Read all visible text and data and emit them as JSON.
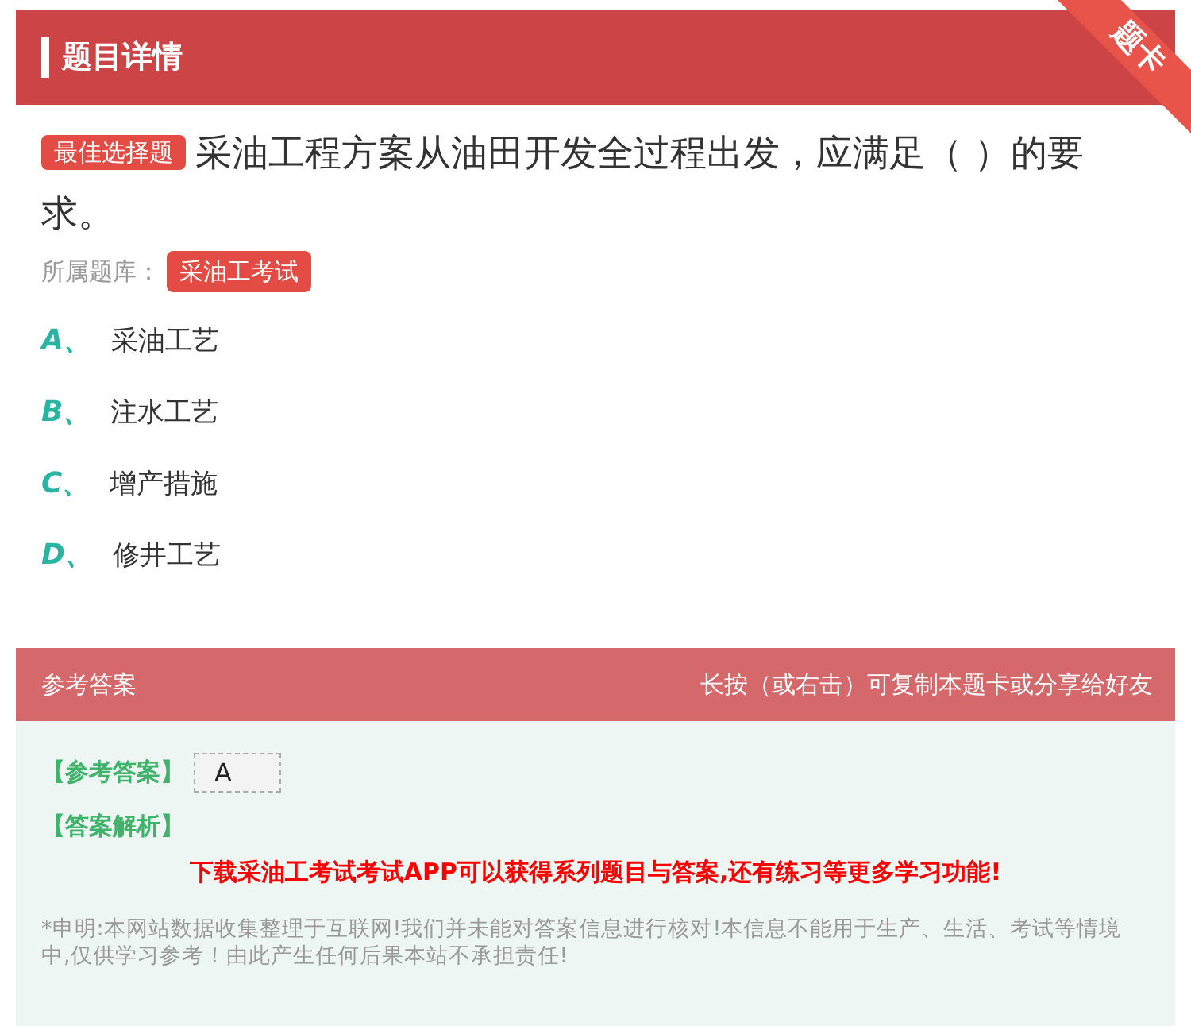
{
  "header": {
    "title": "题目详情",
    "ribbon": "题卡"
  },
  "question": {
    "type_tag": "最佳选择题",
    "text": "采油工程方案从油田开发全过程出发，应满足（ ）的要求。",
    "bank_label": "所属题库：",
    "bank": "采油工考试"
  },
  "options": [
    {
      "letter": "A、",
      "text": "采油工艺"
    },
    {
      "letter": "B、",
      "text": "注水工艺"
    },
    {
      "letter": "C、",
      "text": "增产措施"
    },
    {
      "letter": "D、",
      "text": "修井工艺"
    }
  ],
  "answer_panel": {
    "title": "参考答案",
    "hint": "长按（或右击）可复制本题卡或分享给好友",
    "answer_label": "【参考答案】",
    "answer": "A",
    "analysis_label": "【答案解析】",
    "promo": "下载采油工考试考试APP可以获得系列题目与答案,还有练习等更多学习功能!",
    "disclaimer": "*申明:本网站数据收集整理于互联网!我们并未能对答案信息进行核对!本信息不能用于生产、生活、考试等情境中,仅供学习参考！由此产生任何后果本站不承担责任!"
  }
}
